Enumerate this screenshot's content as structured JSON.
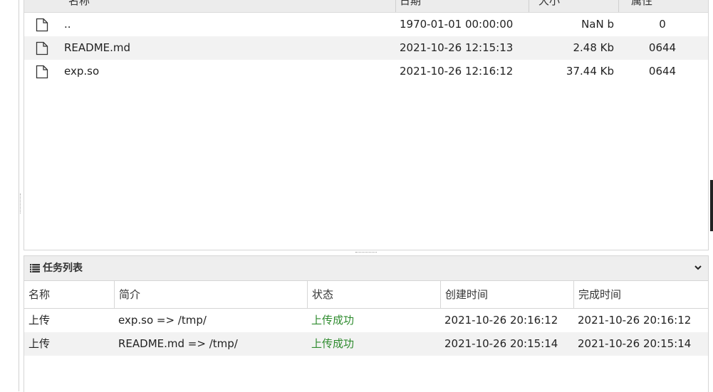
{
  "file_table": {
    "columns": [
      "名称",
      "日期",
      "大小",
      "属性"
    ],
    "rows": [
      {
        "name": "..",
        "date": "1970-01-01 00:00:00",
        "size": "NaN b",
        "attr": "0"
      },
      {
        "name": "README.md",
        "date": "2021-10-26 12:15:13",
        "size": "2.48 Kb",
        "attr": "0644"
      },
      {
        "name": "exp.so",
        "date": "2021-10-26 12:16:12",
        "size": "37.44 Kb",
        "attr": "0644"
      }
    ]
  },
  "task_panel": {
    "title": "任务列表",
    "columns": [
      "名称",
      "简介",
      "状态",
      "创建时间",
      "完成时间"
    ],
    "rows": [
      {
        "name": "上传",
        "desc": "exp.so => /tmp/",
        "status": "上传成功",
        "created": "2021-10-26 20:16:12",
        "finished": "2021-10-26 20:16:12"
      },
      {
        "name": "上传",
        "desc": "README.md => /tmp/",
        "status": "上传成功",
        "created": "2021-10-26 20:15:14",
        "finished": "2021-10-26 20:15:14"
      }
    ]
  },
  "icons": {
    "file": "file-icon",
    "task_list": "list-icon",
    "collapse": "chevron-down-icon"
  },
  "colors": {
    "success": "#2e8b2e",
    "header_bg": "#ececec",
    "alt_row": "#f2f2f2"
  }
}
